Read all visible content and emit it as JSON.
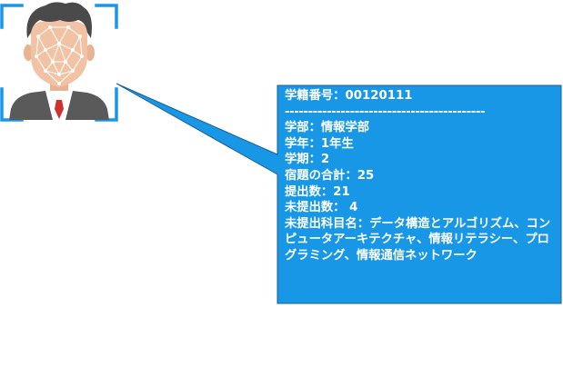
{
  "avatar": {
    "icon": "face-recognition-avatar-icon",
    "colors": {
      "hair": "#4a4a4a",
      "skin": "#f1c3a4",
      "face_mesh": "#ffffff",
      "shirt": "#ffffff",
      "jacket": "#595959",
      "tie": "#d32f2f",
      "scan_brackets": "#1897e6"
    }
  },
  "callout": {
    "bg_color": "#1897e6",
    "border_color": "#1c5f94",
    "text_color": "#ffffff",
    "student_id": "学籍番号：00120111",
    "divider": "-------------------------------------------",
    "faculty": "学部：情報学部",
    "year": "学年：1年生",
    "term": "学期：2",
    "homework_total": "宿題の合計：25",
    "submitted": "提出数：21",
    "unsubmitted": "未提出数： 4",
    "unsubmitted_subjects": "未提出科目名：データ構造とアルゴリズム、コンピュータアーキテクチャ、情報リテラシー、プログラミング、情報通信ネットワーク"
  }
}
